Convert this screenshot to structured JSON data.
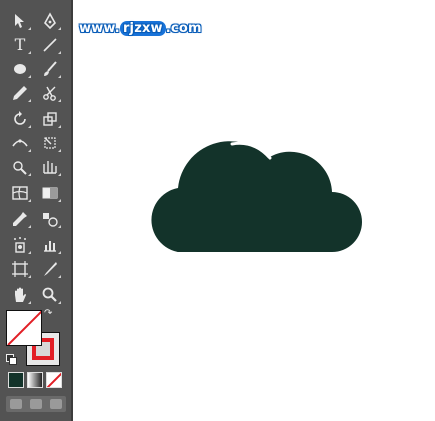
{
  "watermark": {
    "text_prefix": "www.",
    "text_highlight": "rjzxw",
    "text_suffix": ".com"
  },
  "toolbar": {
    "tools": [
      {
        "name": "selection-tool",
        "icon": "arrow-icon"
      },
      {
        "name": "pen-tool",
        "icon": "pen-icon"
      },
      {
        "name": "type-tool",
        "icon": "text-icon",
        "glyph": "T"
      },
      {
        "name": "line-tool",
        "icon": "line-icon"
      },
      {
        "name": "ellipse-tool",
        "icon": "ellipse-icon"
      },
      {
        "name": "brush-tool",
        "icon": "brush-icon"
      },
      {
        "name": "pencil-tool",
        "icon": "pencil-icon"
      },
      {
        "name": "scissors-tool",
        "icon": "scissors-icon"
      },
      {
        "name": "rotate-tool",
        "icon": "rotate-icon"
      },
      {
        "name": "scale-tool",
        "icon": "scale-icon"
      },
      {
        "name": "width-tool",
        "icon": "width-icon"
      },
      {
        "name": "free-transform-tool",
        "icon": "free-transform-icon"
      },
      {
        "name": "shape-builder-tool",
        "icon": "shape-builder-icon"
      },
      {
        "name": "perspective-grid-tool",
        "icon": "perspective-icon"
      },
      {
        "name": "mesh-tool",
        "icon": "mesh-icon"
      },
      {
        "name": "gradient-tool",
        "icon": "gradient-icon"
      },
      {
        "name": "eyedropper-tool",
        "icon": "eyedropper-icon"
      },
      {
        "name": "blend-tool",
        "icon": "blend-icon"
      },
      {
        "name": "symbol-sprayer-tool",
        "icon": "symbol-sprayer-icon"
      },
      {
        "name": "graph-tool",
        "icon": "graph-icon"
      },
      {
        "name": "artboard-tool",
        "icon": "artboard-icon"
      },
      {
        "name": "slice-tool",
        "icon": "slice-icon"
      },
      {
        "name": "hand-tool",
        "icon": "hand-icon"
      },
      {
        "name": "zoom-tool",
        "icon": "zoom-icon"
      }
    ]
  },
  "colors": {
    "toolbar_bg": "#535353",
    "cloud_fill": "#13332a",
    "cloud_highlight": "#ffffff",
    "stroke_color": "#e21f26",
    "watermark_blue": "#1973d9"
  },
  "canvas": {
    "shape": "cloud-icon"
  }
}
